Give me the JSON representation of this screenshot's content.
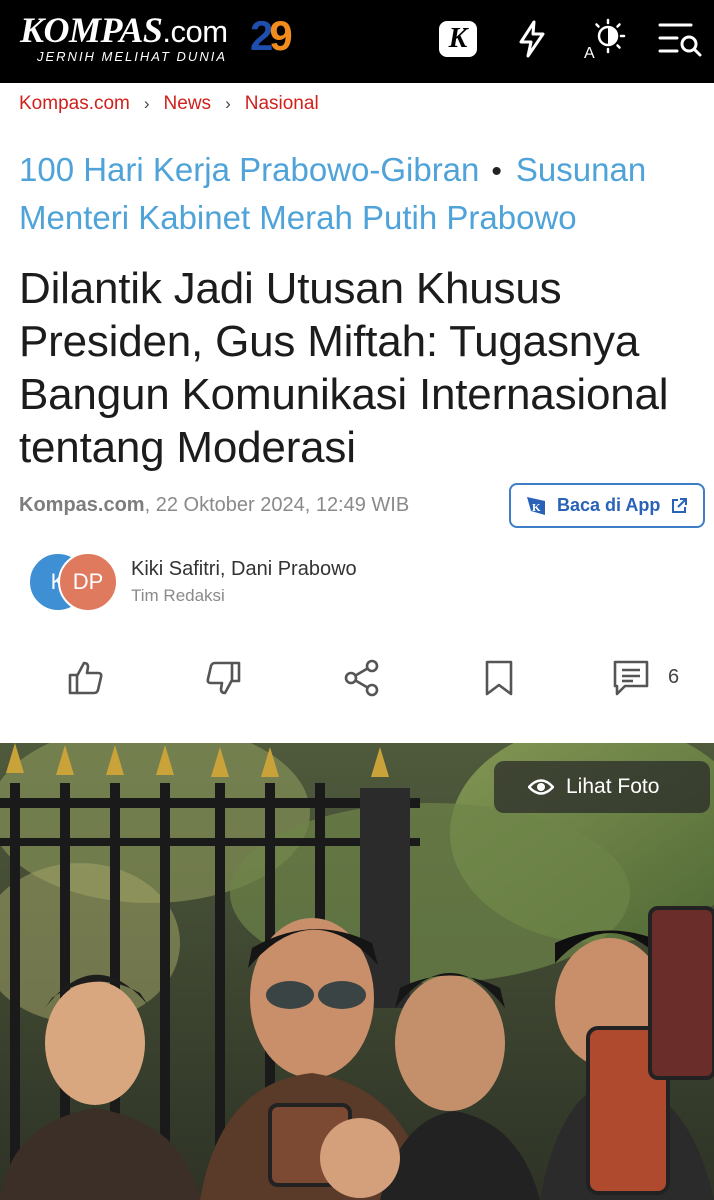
{
  "header": {
    "logo_main": "KOMPAS",
    "logo_suffix": ".com",
    "logo_tagline": "JERNIH MELIHAT DUNIA",
    "anniversary_digit_1": "2",
    "anniversary_digit_2": "9",
    "k_button_label": "K"
  },
  "breadcrumb": [
    "Kompas.com",
    "News",
    "Nasional"
  ],
  "topics": [
    "100 Hari Kerja Prabowo-Gibran",
    "Susunan Menteri Kabinet Merah Putih Prabowo"
  ],
  "article": {
    "title": "Dilantik Jadi Utusan Khusus Presiden, Gus Miftah: Tugasnya Bangun Komunikasi Internasional tentang Moderasi",
    "source": "Kompas.com",
    "date": ", 22 Oktober 2024, 12:49 WIB",
    "app_button": "Baca di App",
    "authors": "Kiki Safitri, Dani Prabowo",
    "team_label": "Tim Redaksi",
    "avatar_1": "K",
    "avatar_2": "DP",
    "comment_count": "6"
  },
  "photo": {
    "view_label": "Lihat Foto"
  },
  "colors": {
    "header_bg": "#000000",
    "breadcrumb": "#d0211c",
    "topic_link": "#4fa3d8",
    "app_button": "#2a62b8"
  }
}
